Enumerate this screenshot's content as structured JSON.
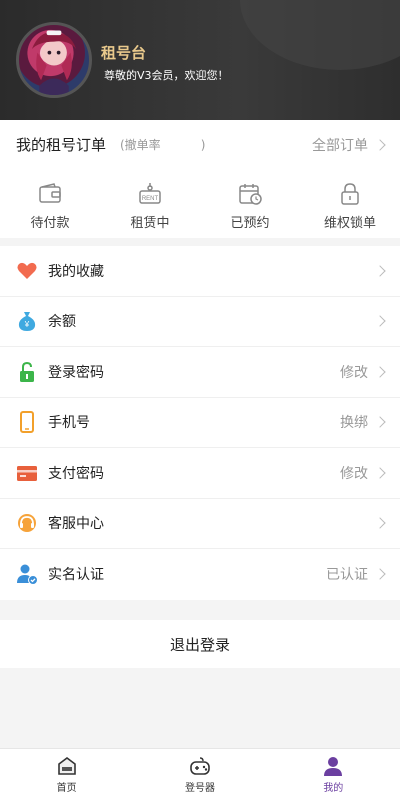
{
  "header": {
    "brand": "租号台",
    "welcome": "尊敬的V3会员，欢迎您！"
  },
  "orders": {
    "title": "我的租号订单",
    "rate_label": "(撤单率",
    "rate_close": ")",
    "all_label": "全部订单",
    "tabs": [
      {
        "label": "待付款",
        "icon": "wallet-icon"
      },
      {
        "label": "租赁中",
        "icon": "rent-tag-icon"
      },
      {
        "label": "已预约",
        "icon": "calendar-clock-icon"
      },
      {
        "label": "维权锁单",
        "icon": "lock-icon"
      }
    ]
  },
  "menu": [
    {
      "label": "我的收藏",
      "value": "",
      "icon": "heart-icon"
    },
    {
      "label": "余额",
      "value": "",
      "icon": "money-bag-icon"
    },
    {
      "label": "登录密码",
      "value": "修改",
      "icon": "padlock-icon"
    },
    {
      "label": "手机号",
      "value": "换绑",
      "icon": "phone-icon"
    },
    {
      "label": "支付密码",
      "value": "修改",
      "icon": "card-icon"
    },
    {
      "label": "客服中心",
      "value": "",
      "icon": "headset-icon"
    },
    {
      "label": "实名认证",
      "value": "已认证",
      "icon": "verified-user-icon"
    }
  ],
  "logout": "退出登录",
  "tabbar": [
    {
      "label": "首页",
      "icon": "home-icon",
      "active": false
    },
    {
      "label": "登号器",
      "icon": "gamepad-icon",
      "active": false
    },
    {
      "label": "我的",
      "icon": "user-icon",
      "active": true
    }
  ],
  "colors": {
    "accent": "#6b3fa0",
    "brand_gold": "#e9c98c"
  }
}
